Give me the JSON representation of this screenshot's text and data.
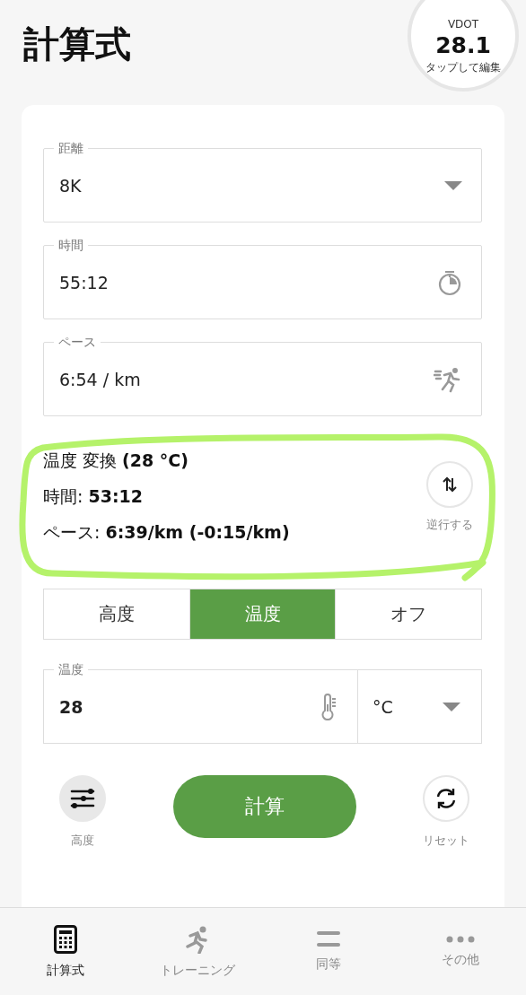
{
  "header": {
    "title": "計算式",
    "vdot": {
      "label": "VDOT",
      "value": "28.1",
      "hint": "タップして編集"
    }
  },
  "fields": [
    {
      "kind": "select",
      "label": "距離",
      "value": "8K"
    },
    {
      "kind": "timer",
      "label": "時間",
      "value": "55:12"
    },
    {
      "kind": "pace",
      "label": "ペース",
      "value": "6:54 / km"
    }
  ],
  "result": {
    "lines": [
      "温度 変換 **(28 °C)**",
      "時間:  **53:12**",
      "ペース:  **6:39/km (-0:15/km)**"
    ],
    "reverse_label": "逆行する"
  },
  "segments": [
    {
      "label": "高度",
      "selected": false
    },
    {
      "label": "温度",
      "selected": true
    },
    {
      "label": "オフ",
      "selected": false
    }
  ],
  "temperature": {
    "label": "温度",
    "value": "28",
    "unit": "°C"
  },
  "actions": {
    "left_label": "高度",
    "calculate": "計算",
    "reset_label": "リセット"
  },
  "tabs": [
    {
      "kind": "calculator",
      "label": "計算式",
      "selected": true
    },
    {
      "kind": "runner",
      "label": "トレーニング",
      "selected": false
    },
    {
      "kind": "equals",
      "label": "同等",
      "selected": false
    },
    {
      "kind": "more",
      "label": "その他",
      "selected": false
    }
  ]
}
